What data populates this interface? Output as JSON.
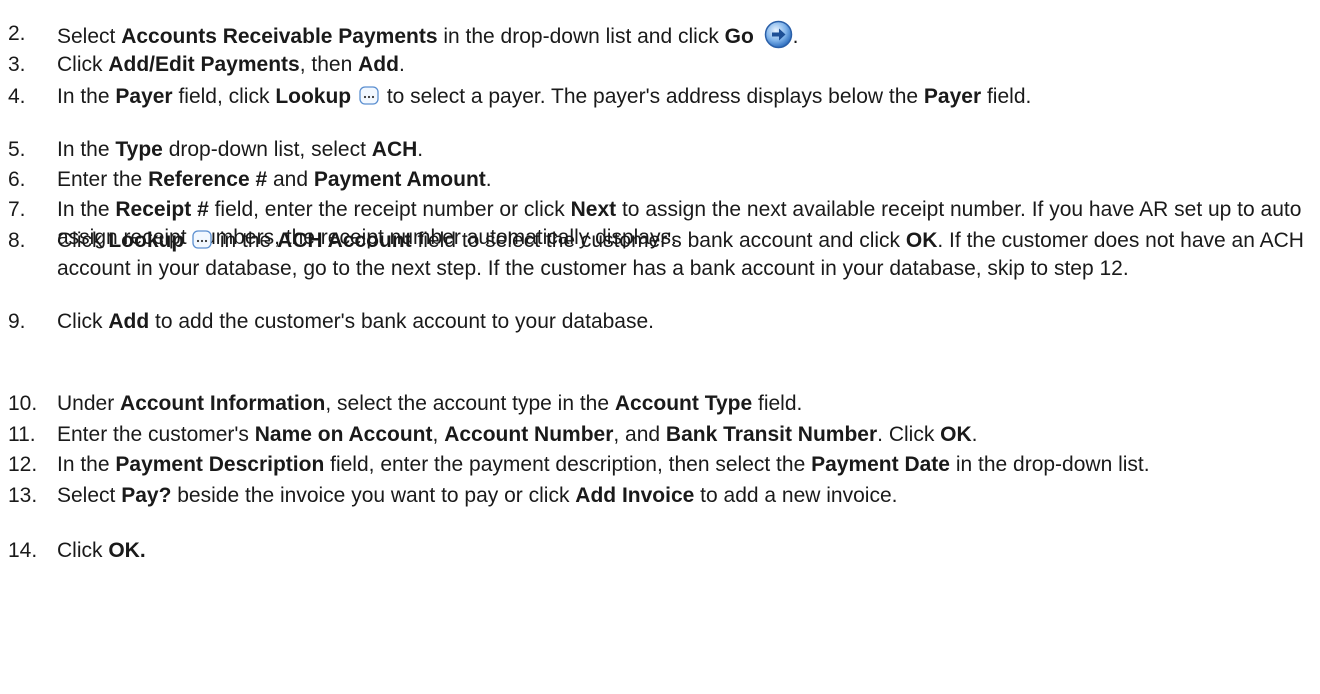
{
  "steps": [
    {
      "num": "2.",
      "parts": [
        {
          "t": "Select "
        },
        {
          "t": "Accounts Receivable Payments",
          "b": true
        },
        {
          "t": " in the drop-down list and click "
        },
        {
          "t": "Go",
          "b": true
        },
        {
          "t": " "
        },
        {
          "icon": "go-arrow-icon"
        },
        {
          "t": "."
        }
      ]
    },
    {
      "num": "3.",
      "parts": [
        {
          "t": "Click "
        },
        {
          "t": "Add/Edit Payments",
          "b": true
        },
        {
          "t": ", then "
        },
        {
          "t": "Add",
          "b": true
        },
        {
          "t": "."
        }
      ]
    },
    {
      "num": "4.",
      "parts": [
        {
          "t": "In the "
        },
        {
          "t": "Payer",
          "b": true
        },
        {
          "t": " field, click "
        },
        {
          "t": "Lookup",
          "b": true
        },
        {
          "t": " "
        },
        {
          "icon": "lookup-icon"
        },
        {
          "t": " to select a payer. The payer's address displays below the "
        },
        {
          "t": "Payer",
          "b": true
        },
        {
          "t": " field."
        }
      ]
    },
    {
      "num": "5.",
      "parts": [
        {
          "t": "In the "
        },
        {
          "t": "Type",
          "b": true
        },
        {
          "t": " drop-down list, select "
        },
        {
          "t": "ACH",
          "b": true
        },
        {
          "t": "."
        }
      ]
    },
    {
      "num": "6.",
      "parts": [
        {
          "t": "Enter the "
        },
        {
          "t": "Reference #",
          "b": true
        },
        {
          "t": " and "
        },
        {
          "t": "Payment Amount",
          "b": true
        },
        {
          "t": "."
        }
      ]
    },
    {
      "num": "7.",
      "parts": [
        {
          "t": "In the "
        },
        {
          "t": "Receipt #",
          "b": true
        },
        {
          "t": " field, enter the receipt number or click "
        },
        {
          "t": "Next",
          "b": true
        },
        {
          "t": " to assign the next available receipt number. If you have AR set up to auto assign receipt numbers, the receipt number automatically displays."
        }
      ]
    },
    {
      "num": "8.",
      "parts": [
        {
          "t": "Click "
        },
        {
          "t": "Lookup",
          "b": true
        },
        {
          "t": " "
        },
        {
          "icon": "lookup-icon"
        },
        {
          "t": " in the "
        },
        {
          "t": "ACH Account",
          "b": true
        },
        {
          "t": " field to select the customer's bank account and click "
        },
        {
          "t": "OK",
          "b": true
        },
        {
          "t": ". If the customer does not have an ACH account in your database, go to the next step. If the customer has a bank account in your database, skip to step 12."
        }
      ]
    },
    {
      "num": "9.",
      "parts": [
        {
          "t": "Click "
        },
        {
          "t": "Add",
          "b": true
        },
        {
          "t": " to add the customer's bank account to your database."
        }
      ]
    },
    {
      "num": "10.",
      "parts": [
        {
          "t": "Under "
        },
        {
          "t": "Account Information",
          "b": true
        },
        {
          "t": ", select the account type in the "
        },
        {
          "t": "Account Type",
          "b": true
        },
        {
          "t": " field."
        }
      ]
    },
    {
      "num": "11.",
      "parts": [
        {
          "t": "Enter the customer's "
        },
        {
          "t": "Name on Account",
          "b": true
        },
        {
          "t": ", "
        },
        {
          "t": "Account Number",
          "b": true
        },
        {
          "t": ", and "
        },
        {
          "t": "Bank Transit Number",
          "b": true
        },
        {
          "t": ". Click "
        },
        {
          "t": "OK",
          "b": true
        },
        {
          "t": "."
        }
      ]
    },
    {
      "num": "12.",
      "parts": [
        {
          "t": "In the "
        },
        {
          "t": "Payment Description",
          "b": true
        },
        {
          "t": " field, enter the payment description, then select the "
        },
        {
          "t": "Payment Date",
          "b": true
        },
        {
          "t": " in the drop-down list."
        }
      ]
    },
    {
      "num": "13.",
      "parts": [
        {
          "t": "Select "
        },
        {
          "t": "Pay?",
          "b": true
        },
        {
          "t": " beside the invoice you want to pay or click "
        },
        {
          "t": "Add Invoice",
          "b": true
        },
        {
          "t": " to add a new invoice."
        }
      ]
    },
    {
      "num": "14.",
      "parts": [
        {
          "t": "Click "
        },
        {
          "t": "OK.",
          "b": true
        }
      ]
    }
  ]
}
